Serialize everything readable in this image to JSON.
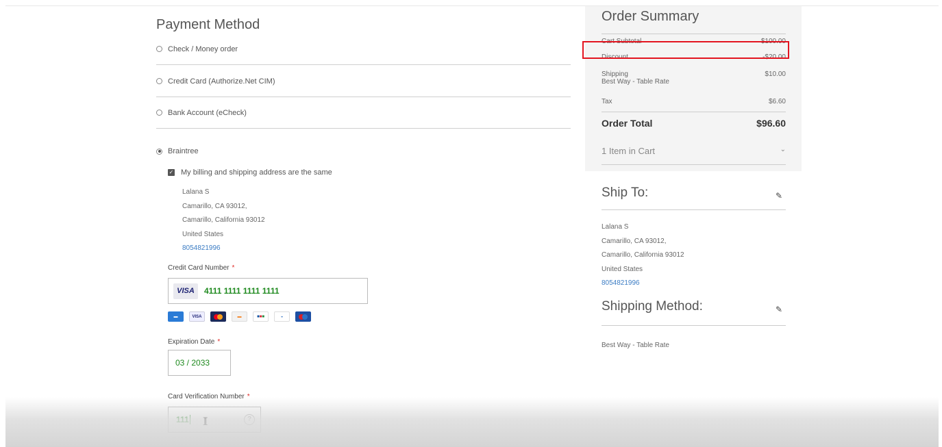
{
  "payment": {
    "title": "Payment Method",
    "methods": [
      {
        "label": "Check / Money order"
      },
      {
        "label": "Credit Card (Authorize.Net CIM)"
      },
      {
        "label": "Bank Account (eCheck)"
      }
    ],
    "selected_method": "Braintree",
    "billing_same_label": "My billing and shipping address are the same",
    "billing_same_checked": true,
    "address": {
      "name": "Lalana S",
      "line1": "Camarillo, CA 93012,",
      "line2": "Camarillo, California 93012",
      "country": "United States",
      "phone": "8054821996"
    },
    "cc_number_label": "Credit Card Number",
    "cc_brand": "VISA",
    "cc_number_value": "4111 1111 1111 1111",
    "card_logos": [
      "amex-icon",
      "visa-icon",
      "mastercard-icon",
      "discover-icon",
      "jcb-icon",
      "diners-icon",
      "maestro-icon"
    ],
    "exp_label": "Expiration Date",
    "exp_value": "03 / 2033",
    "cvv_label": "Card Verification Number",
    "cvv_value": "111",
    "required_mark": "*",
    "help_glyph": "?"
  },
  "summary": {
    "title": "Order Summary",
    "rows": [
      {
        "label": "Cart Subtotal",
        "value": "$100.00"
      },
      {
        "label": "Discount",
        "value": "-$20.00"
      },
      {
        "label": "Shipping",
        "sub": "Best Way - Table Rate",
        "value": "$10.00"
      },
      {
        "label": "Tax",
        "value": "$6.60"
      }
    ],
    "total_label": "Order Total",
    "total_value": "$96.60",
    "items_label": "1 Item in Cart"
  },
  "ship_to": {
    "title": "Ship To:",
    "name": "Lalana S",
    "line1": "Camarillo, CA 93012,",
    "line2": "Camarillo, California 93012",
    "country": "United States",
    "phone": "8054821996"
  },
  "shipping_method": {
    "title": "Shipping Method:",
    "value": "Best Way - Table Rate"
  },
  "colors": {
    "highlight_box": "#e3141f",
    "input_text": "#1f8a1f",
    "link": "#3b7cc4"
  }
}
